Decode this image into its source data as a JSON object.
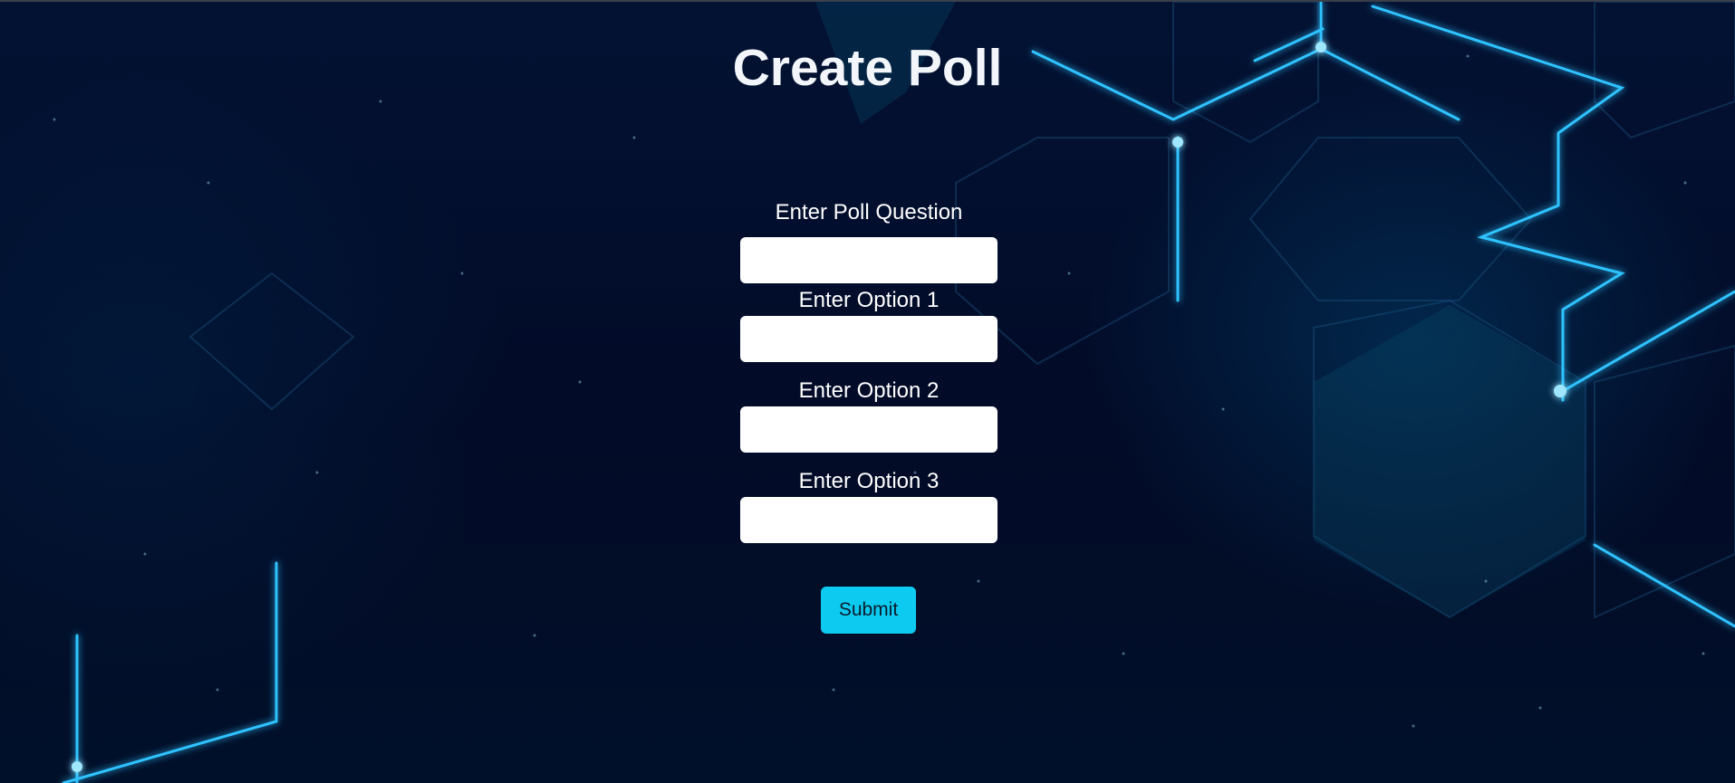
{
  "page": {
    "title": "Create Poll"
  },
  "form": {
    "fields": [
      {
        "label": "Enter Poll Question",
        "value": ""
      },
      {
        "label": "Enter Option 1",
        "value": ""
      },
      {
        "label": "Enter Option 2",
        "value": ""
      },
      {
        "label": "Enter Option 3",
        "value": ""
      }
    ],
    "submit_label": "Submit"
  },
  "colors": {
    "background": "#020c26",
    "accent": "#0dcaf0",
    "glow": "#2fc3ff"
  }
}
